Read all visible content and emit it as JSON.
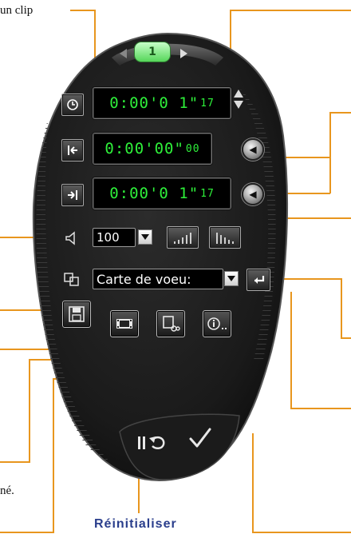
{
  "annotations": {
    "top_left_text": "un clip",
    "left_note_text": "né.",
    "reset_label": "Réinitialiser"
  },
  "panel": {
    "page_tab": "1",
    "lcd_clip_duration": {
      "main": "0:00'0 1\"",
      "frames": "17"
    },
    "lcd_mark_in": {
      "main": "0:00'00\"",
      "frames": "00"
    },
    "lcd_mark_out": {
      "main": "0:00'0 1\"",
      "frames": "17"
    },
    "volume_value": "100",
    "transition_select": "Carte de voeu:",
    "icons": {
      "duration": "clock-icon",
      "mark_in": "mark-in-icon",
      "mark_out": "mark-out-icon",
      "volume": "speaker-icon",
      "transition": "transition-icon",
      "save": "save-disk-icon",
      "film": "film-icon",
      "cut": "film-cut-icon",
      "info": "info-icon",
      "reset": "reset-icon",
      "ok": "checkmark-icon"
    }
  },
  "colors": {
    "callout_line": "#e8961e",
    "lcd_text": "#2ef03a",
    "reset_label": "#2a3e8c",
    "panel_dark": "#1c1c1c"
  }
}
